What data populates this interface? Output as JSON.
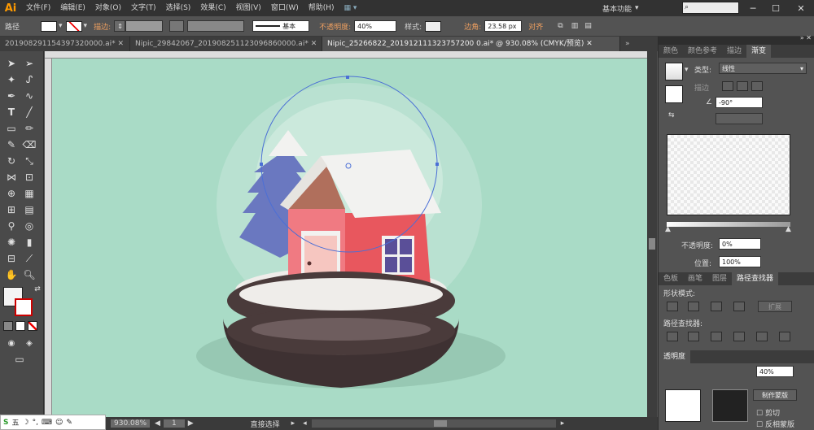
{
  "app": {
    "logo": "Ai",
    "workspace": "基本功能"
  },
  "menu": [
    "文件(F)",
    "编辑(E)",
    "对象(O)",
    "文字(T)",
    "选择(S)",
    "效果(C)",
    "视图(V)",
    "窗口(W)",
    "帮助(H)"
  ],
  "control_bar": {
    "selection_label": "路径",
    "stroke_label": "描边:",
    "brush_label": "基本",
    "opacity_label": "不透明度:",
    "opacity_value": "40%",
    "style_label": "样式:",
    "corner_label": "边角:",
    "corner_value": "23.58 px",
    "align_label": "对齐"
  },
  "doc_tabs": [
    {
      "label": "201908291154397320000.ai*",
      "active": false
    },
    {
      "label": "Nipic_29842067_201908251123096860000.ai*",
      "active": false
    },
    {
      "label": "Nipic_25266822_201912111323757200 0.ai* @ 930.08% (CMYK/预览)",
      "active": true
    }
  ],
  "panel_gradient": {
    "tabs": [
      "颜色",
      "颜色参考",
      "描边",
      "渐变"
    ],
    "active_tab": "渐变",
    "type_label": "类型:",
    "type_value": "线性",
    "stroke_label": "描边",
    "angle_value": "-90°",
    "opacity_label": "不透明度:",
    "opacity_value": "0%",
    "location_label": "位置:",
    "location_value": "100%"
  },
  "panel_pathfinder": {
    "tabs": [
      "色板",
      "画笔",
      "图层",
      "路径查找器"
    ],
    "active_tab": "路径查找器",
    "shape_mode_label": "形状模式:",
    "expand_label": "扩展",
    "pathfinder_label": "路径查找器:"
  },
  "panel_transparency": {
    "tabs": [
      "透明度"
    ],
    "opacity_value": "40%",
    "make_mask_label": "制作蒙版",
    "clip_label": "剪切",
    "invert_label": "反相蒙版"
  },
  "status_bar": {
    "zoom": "930.08%",
    "artboard_num": "1",
    "tool_label": "直接选择"
  },
  "ime": {
    "label": "五"
  },
  "colors": {
    "artboard_bg": "#a9dbc6",
    "house_wall": "#e8575e",
    "roof_snow": "#f2f2f0",
    "base_dark": "#4a3b3b",
    "tree": "#6a78c0",
    "accent_orange": "#ff9a00"
  }
}
